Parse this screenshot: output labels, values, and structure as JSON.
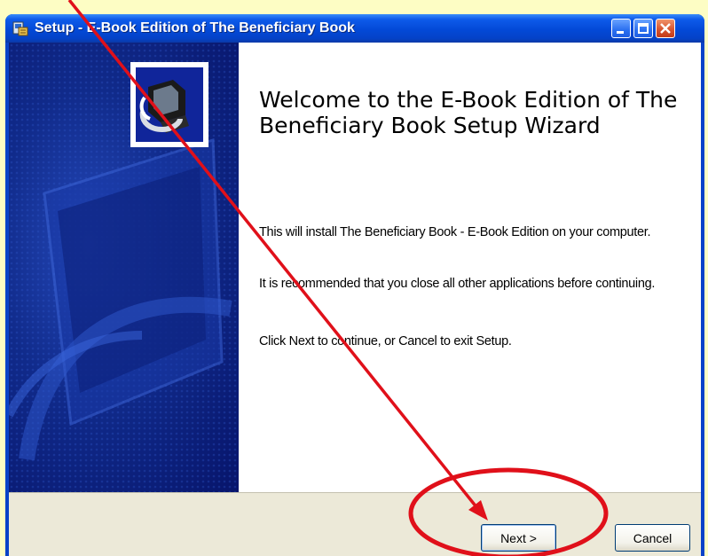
{
  "window": {
    "title": "Setup - E-Book Edition of The Beneficiary Book"
  },
  "main": {
    "heading": "Welcome to the E-Book Edition of The Beneficiary Book Setup Wizard",
    "paragraphs": [
      "This will install The Beneficiary Book - E-Book Edition on your computer.",
      "It is recommended that you close all other applications before continuing.",
      "Click Next to continue, or Cancel to exit Setup."
    ]
  },
  "buttons": {
    "next_label": "Next >",
    "cancel_label": "Cancel"
  },
  "colors": {
    "background": "#fdfdc4",
    "annotation": "#e0101a",
    "titlebar": "#0349d7",
    "side_panel": "#102a8a"
  },
  "icons": {
    "app": "setup-icon",
    "logo": "computer-install-icon"
  }
}
